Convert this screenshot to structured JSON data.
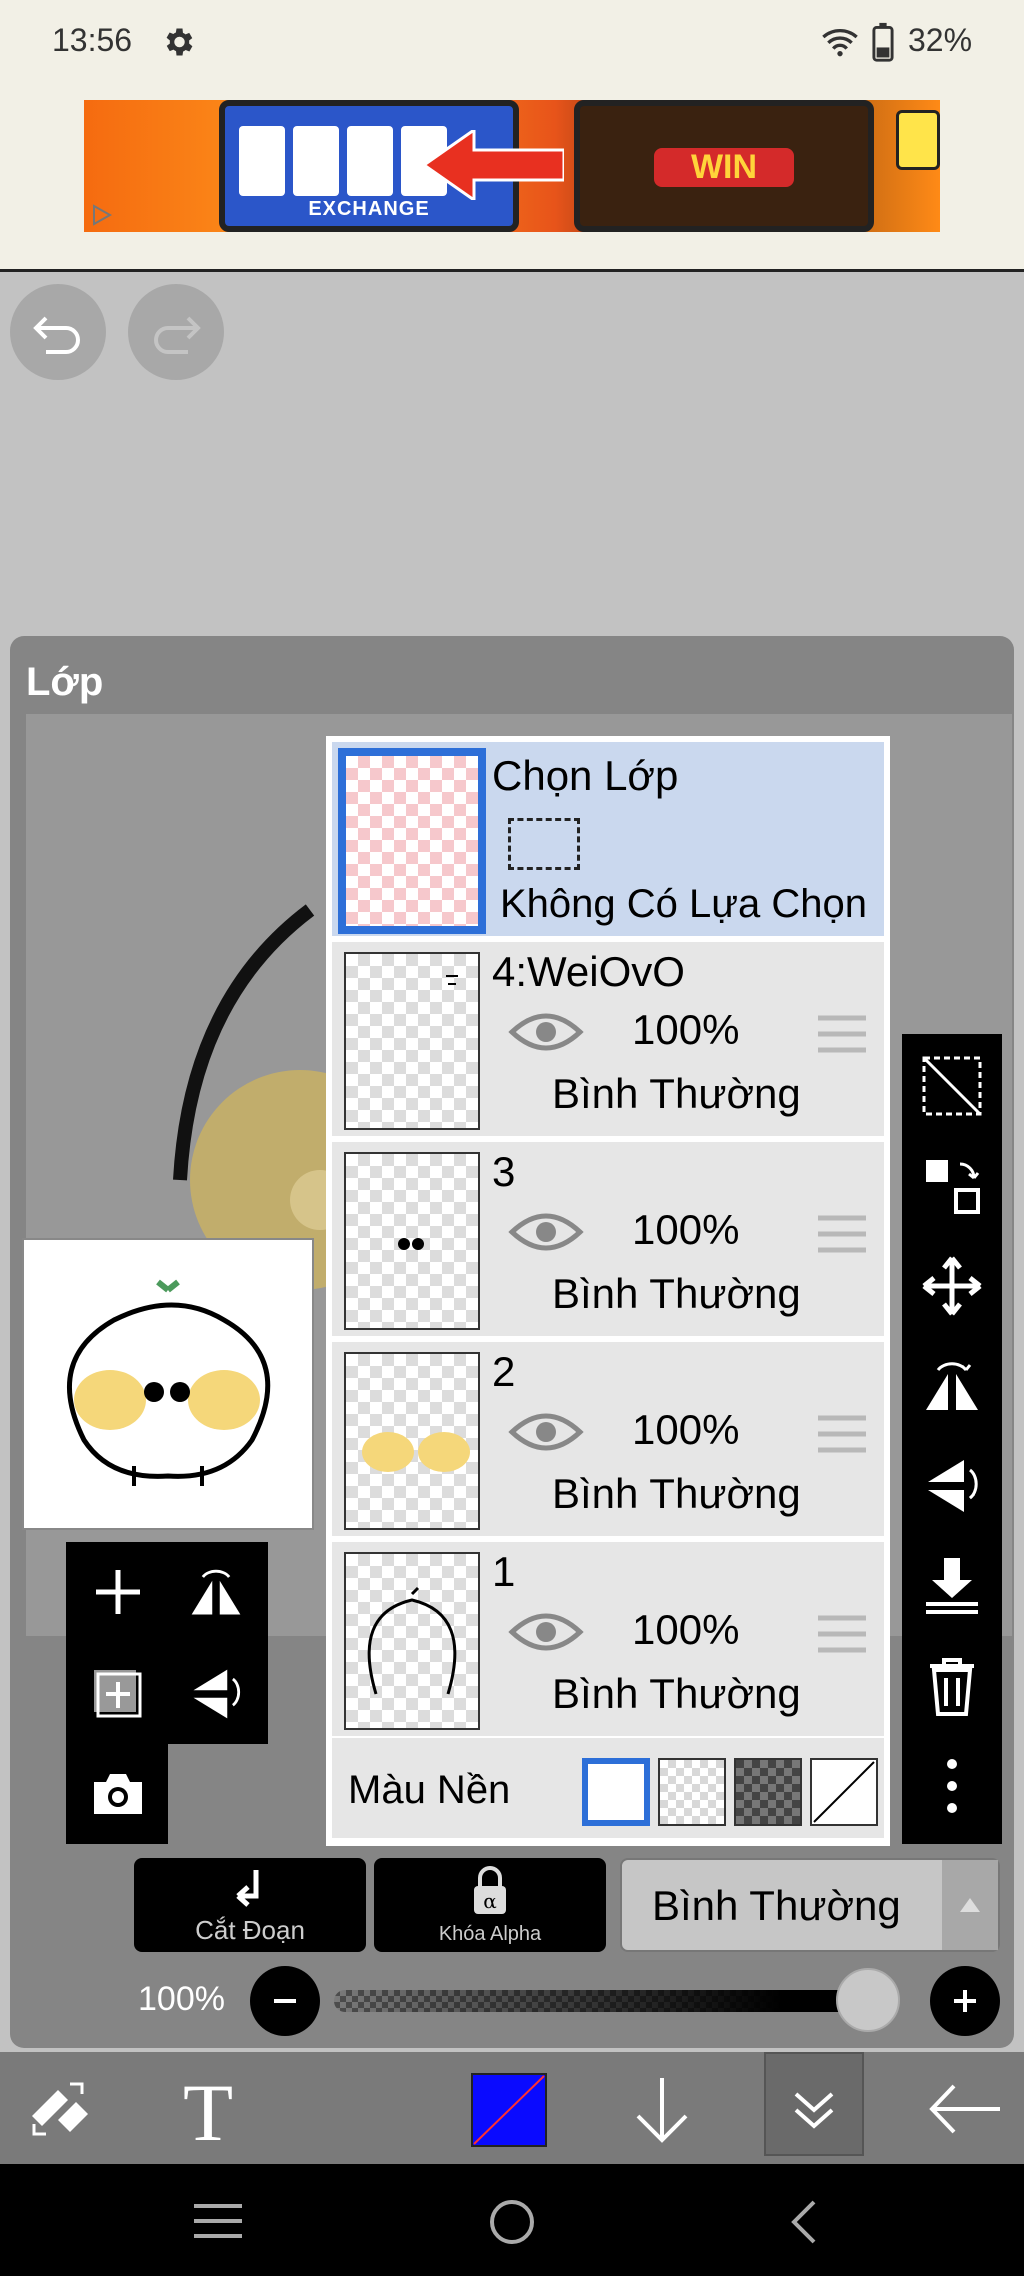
{
  "status_bar": {
    "time": "13:56",
    "battery": "32%"
  },
  "ad": {
    "exchange_label": "EXCHANGE",
    "win_label": "WIN"
  },
  "layer_panel": {
    "title": "Lớp",
    "select_row": {
      "title": "Chọn Lớp",
      "status": "Không Có Lựa Chọn"
    },
    "layers": [
      {
        "name": "4:WeiOvO",
        "opacity": "100%",
        "blend": "Bình Thường"
      },
      {
        "name": "3",
        "opacity": "100%",
        "blend": "Bình Thường"
      },
      {
        "name": "2",
        "opacity": "100%",
        "blend": "Bình Thường"
      },
      {
        "name": "1",
        "opacity": "100%",
        "blend": "Bình Thường"
      }
    ],
    "background": {
      "label": "Màu Nền",
      "selected": "white"
    }
  },
  "controls": {
    "clip_label": "Cắt Đoạn",
    "alpha_lock_label": "Khóa Alpha",
    "blend_mode": "Bình Thường",
    "opacity_label": "100%",
    "opacity_value": 1.0
  },
  "colors": {
    "accent": "#2d6fd8",
    "current_color": "#0a0aff"
  }
}
